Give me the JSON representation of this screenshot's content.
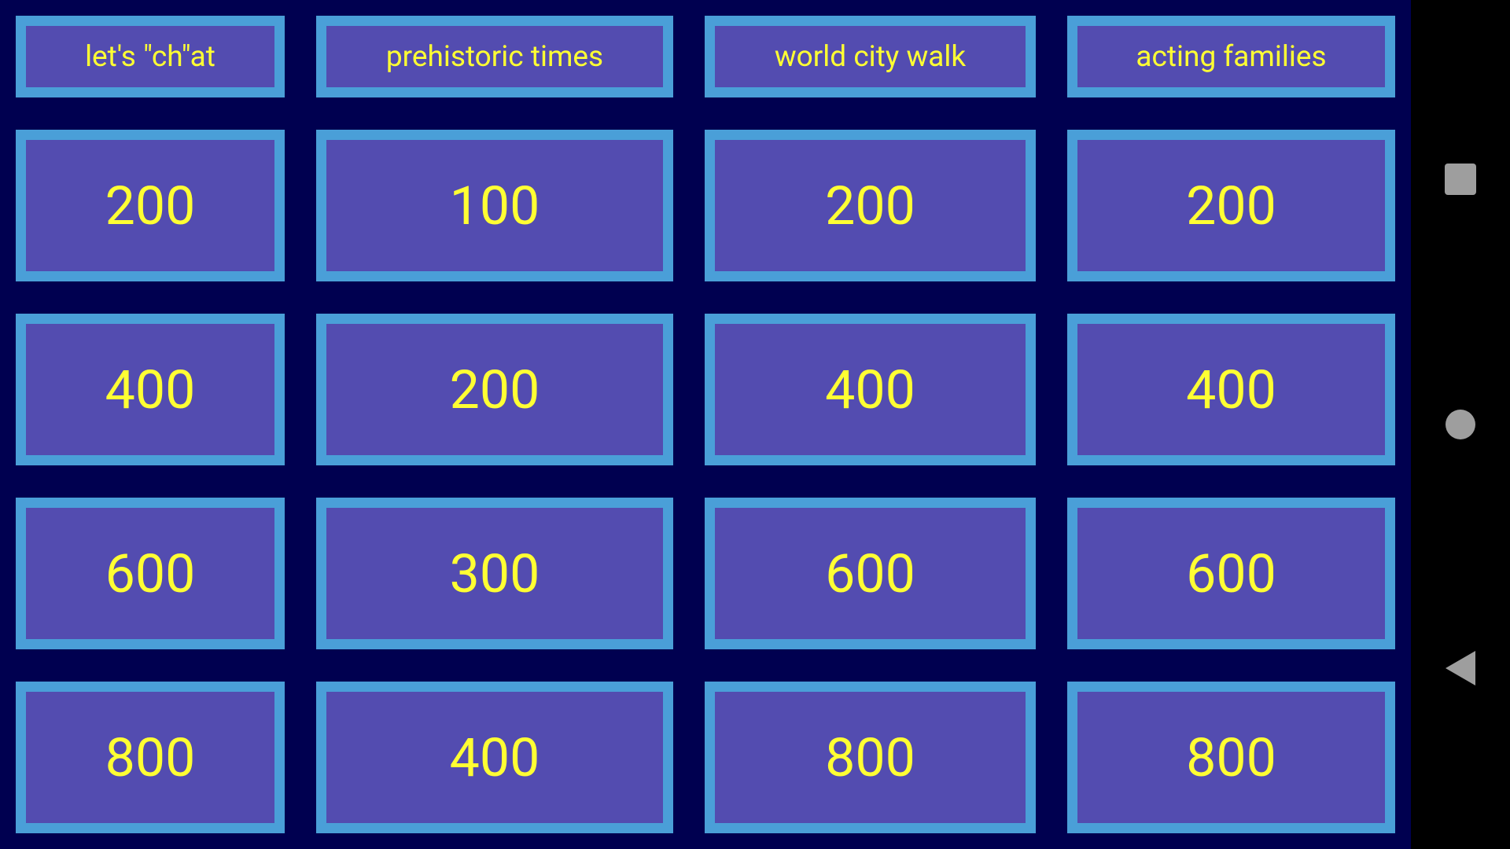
{
  "board": {
    "categories": [
      {
        "title": "let's \"ch\"at",
        "values": [
          "200",
          "400",
          "600",
          "800"
        ]
      },
      {
        "title": "prehistoric times",
        "values": [
          "100",
          "200",
          "300",
          "400"
        ]
      },
      {
        "title": "world city walk",
        "values": [
          "200",
          "400",
          "600",
          "800"
        ]
      },
      {
        "title": "acting families",
        "values": [
          "200",
          "400",
          "600",
          "800"
        ]
      }
    ]
  },
  "navbar": {
    "recents_icon": "square-icon",
    "home_icon": "circle-icon",
    "back_icon": "triangle-back-icon"
  },
  "colors": {
    "background": "#000050",
    "tile_fill": "#534cb0",
    "tile_border": "#4a9fd8",
    "text": "#ffff33",
    "nav_icon": "#9e9e9e"
  }
}
